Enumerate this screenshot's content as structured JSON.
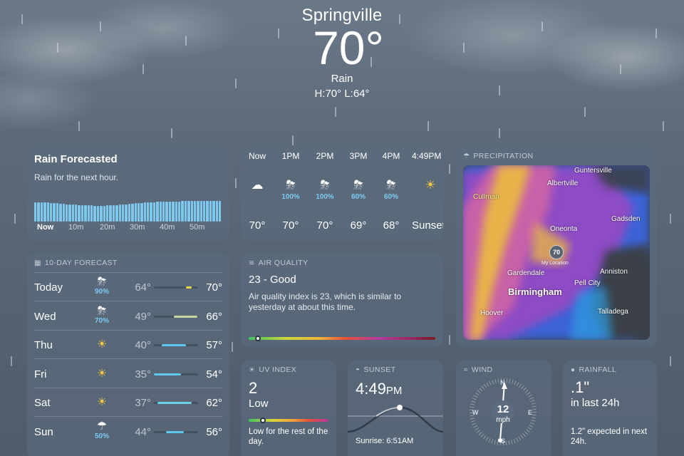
{
  "location": {
    "city": "Springville",
    "temperature": "70°",
    "condition": "Rain",
    "high_low": "H:70°  L:64°"
  },
  "rain_forecast": {
    "title": "Rain Forecasted",
    "subtitle": "Rain for the next hour.",
    "axis": [
      "Now",
      "10m",
      "20m",
      "30m",
      "40m",
      "50m"
    ],
    "intensity": [
      0.78,
      0.8,
      0.8,
      0.79,
      0.78,
      0.77,
      0.76,
      0.75,
      0.74,
      0.73,
      0.72,
      0.71,
      0.7,
      0.7,
      0.69,
      0.68,
      0.68,
      0.67,
      0.67,
      0.66,
      0.66,
      0.66,
      0.66,
      0.67,
      0.67,
      0.68,
      0.69,
      0.7,
      0.71,
      0.72,
      0.73,
      0.74,
      0.75,
      0.76,
      0.77,
      0.78,
      0.79,
      0.8,
      0.8,
      0.81,
      0.82,
      0.82,
      0.82,
      0.83,
      0.83,
      0.83,
      0.83,
      0.84,
      0.84,
      0.84,
      0.84,
      0.84,
      0.84,
      0.85,
      0.85,
      0.85,
      0.85,
      0.85,
      0.85,
      0.86
    ]
  },
  "hourly": [
    {
      "time": "Now",
      "icon": "cloud-rain-icon",
      "pop": "",
      "temp": "70°"
    },
    {
      "time": "1PM",
      "icon": "cloud-bolt-rain-icon",
      "pop": "100%",
      "temp": "70°"
    },
    {
      "time": "2PM",
      "icon": "cloud-bolt-rain-icon",
      "pop": "100%",
      "temp": "70°"
    },
    {
      "time": "3PM",
      "icon": "cloud-bolt-rain-icon",
      "pop": "60%",
      "temp": "69°"
    },
    {
      "time": "4PM",
      "icon": "cloud-bolt-rain-icon",
      "pop": "60%",
      "temp": "68°"
    },
    {
      "time": "4:49PM",
      "icon": "sunset-icon",
      "pop": "",
      "temp": "Sunset"
    }
  ],
  "precipitation": {
    "header": "PRECIPITATION",
    "places": [
      "Guntersville",
      "Albertville",
      "Cullman",
      "Gadsden",
      "Oneonta",
      "My Location",
      "Gardendale",
      "Anniston",
      "Pell City",
      "Birmingham",
      "Hoover",
      "Talladega"
    ],
    "pin_value": "70"
  },
  "ten_day": {
    "header": "10-DAY FORECAST",
    "days": [
      {
        "name": "Today",
        "icon": "cloud-bolt-rain-icon",
        "pop": "90%",
        "low": "64°",
        "high": "70°",
        "range": [
          0.72,
          0.86
        ],
        "color": "#e8d84a"
      },
      {
        "name": "Wed",
        "icon": "cloud-bolt-rain-icon",
        "pop": "70%",
        "low": "49°",
        "high": "66°",
        "range": [
          0.45,
          0.98
        ],
        "color": "#c8d6a0"
      },
      {
        "name": "Thu",
        "icon": "sun-icon",
        "pop": "",
        "low": "40°",
        "high": "57°",
        "range": [
          0.18,
          0.72
        ],
        "color": "#5cc8ec"
      },
      {
        "name": "Fri",
        "icon": "sun-icon",
        "pop": "",
        "low": "35°",
        "high": "54°",
        "range": [
          0.0,
          0.62
        ],
        "color": "#5cc8ec"
      },
      {
        "name": "Sat",
        "icon": "sun-icon",
        "pop": "",
        "low": "37°",
        "high": "62°",
        "range": [
          0.08,
          0.85
        ],
        "color": "#6cd0e8"
      },
      {
        "name": "Sun",
        "icon": "cloud-rain-icon",
        "pop": "50%",
        "low": "44°",
        "high": "56°",
        "range": [
          0.28,
          0.68
        ],
        "color": "#5cc8ec"
      }
    ]
  },
  "air_quality": {
    "header": "AIR QUALITY",
    "value": "23 - Good",
    "description": "Air quality index is 23, which is similar to yesterday at about this time.",
    "position": 0.05
  },
  "uv_index": {
    "header": "UV INDEX",
    "value": "2",
    "level": "Low",
    "note": "Low for the rest of the day.",
    "position": 0.18
  },
  "sunset": {
    "header": "SUNSET",
    "time": "4:49",
    "ampm": "PM",
    "sunrise": "Sunrise: 6:51AM"
  },
  "wind": {
    "header": "WIND",
    "speed": "12",
    "unit": "mph",
    "directions": {
      "n": "N",
      "e": "E",
      "s": "S",
      "w": "W"
    }
  },
  "rainfall": {
    "header": "RAINFALL",
    "value": ".1\"",
    "period": "in last 24h",
    "note": "1.2\" expected in next 24h."
  }
}
